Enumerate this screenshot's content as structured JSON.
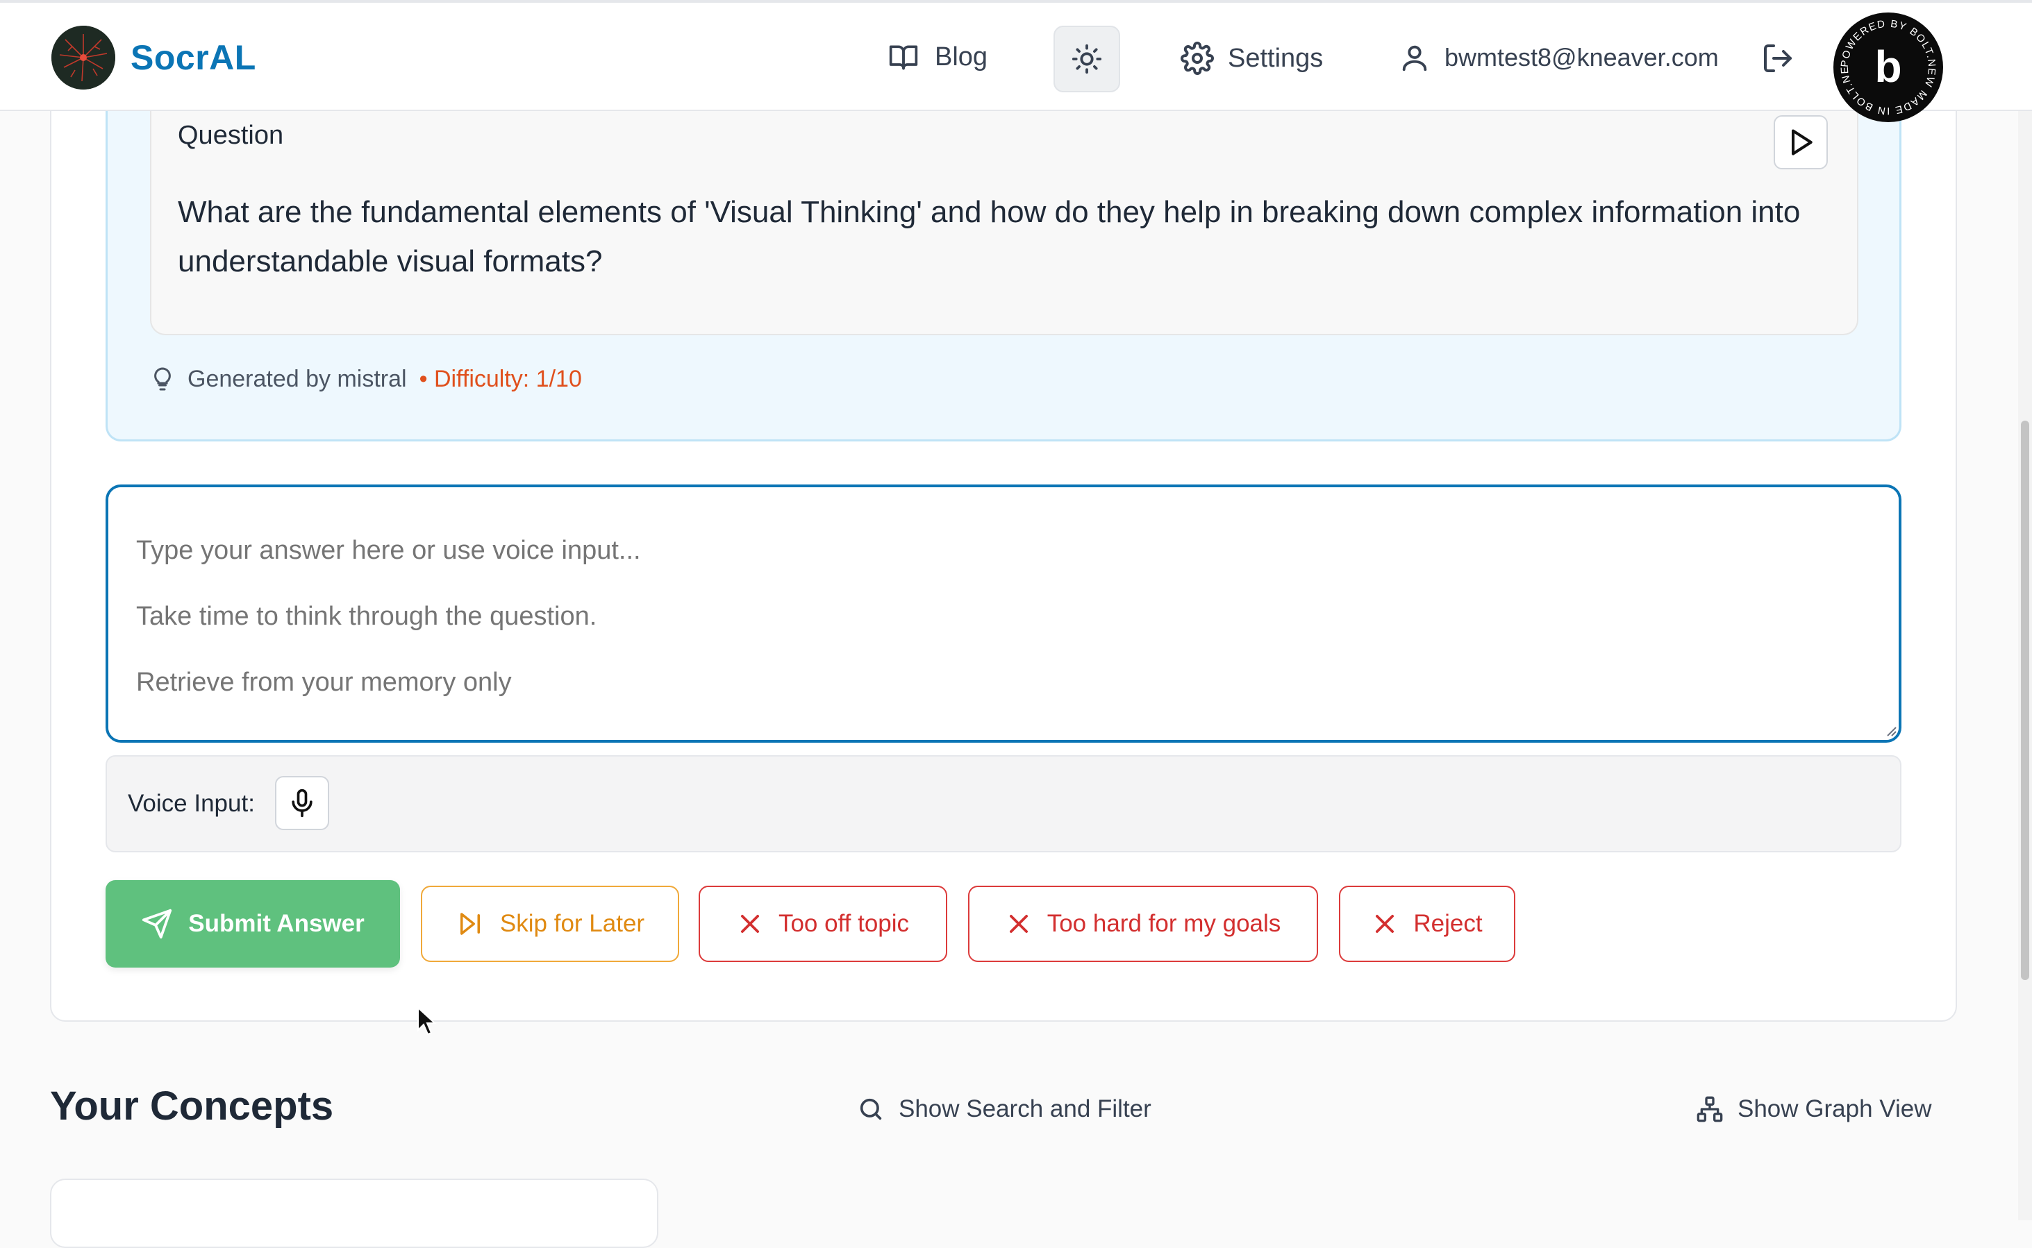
{
  "header": {
    "brand": "SocrAL",
    "blog_label": "Blog",
    "settings_label": "Settings",
    "user_email": "bwmtest8@kneaver.com",
    "bolt_badge_text": "POWERED BY BOLT.NEW MADE IN BOLT.NEW"
  },
  "question": {
    "label": "Question",
    "text": "What are the fundamental elements of 'Visual Thinking' and how do they help in breaking down complex information into understandable visual formats?",
    "generated_by": "Generated by mistral",
    "difficulty": "• Difficulty: 1/10"
  },
  "answer": {
    "placeholder": "Type your answer here or use voice input...\nTake time to think through the question.\nRetrieve from your memory only"
  },
  "voice": {
    "label": "Voice Input:"
  },
  "actions": {
    "submit": "Submit Answer",
    "skip": "Skip for Later",
    "off_topic": "Too off topic",
    "too_hard": "Too hard for my goals",
    "reject": "Reject"
  },
  "concepts": {
    "title": "Your Concepts",
    "show_search": "Show Search and Filter",
    "show_graph": "Show Graph View"
  },
  "colors": {
    "brand": "#0b75b5",
    "submit_green": "#5fc17e",
    "skip_orange": "#e08a12",
    "danger_red": "#d32f2f",
    "difficulty_orange": "#e0501d"
  },
  "icons": [
    "book-icon",
    "sun-icon",
    "gear-icon",
    "user-icon",
    "logout-icon",
    "play-icon",
    "lightbulb-icon",
    "microphone-icon",
    "send-icon",
    "skip-forward-icon",
    "x-icon",
    "search-icon",
    "graph-icon"
  ]
}
